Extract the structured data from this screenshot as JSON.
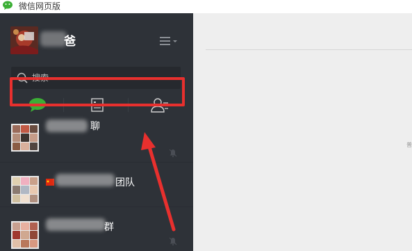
{
  "window": {
    "title": "微信网页版"
  },
  "profile": {
    "nickname_visible": "爸",
    "nickname_partial": "爸"
  },
  "search": {
    "placeholder": "搜索"
  },
  "tabs": [
    {
      "id": "chat",
      "icon": "chat-bubble-icon",
      "active": true
    },
    {
      "id": "articles",
      "icon": "article-card-icon",
      "active": false
    },
    {
      "id": "contacts",
      "icon": "contacts-icon",
      "active": false
    }
  ],
  "chats": [
    {
      "name_visible": "聊",
      "muted": true
    },
    {
      "name_visible": "团队",
      "muted": false
    },
    {
      "name_visible": "群",
      "muted": true
    }
  ],
  "colors": {
    "sidebar_bg": "#2e3238",
    "search_bg": "#26292e",
    "accent_green": "#3caf36",
    "highlight_red": "#e8302e",
    "main_bg": "#eeeeee"
  },
  "main": {
    "edge_text": "普"
  }
}
